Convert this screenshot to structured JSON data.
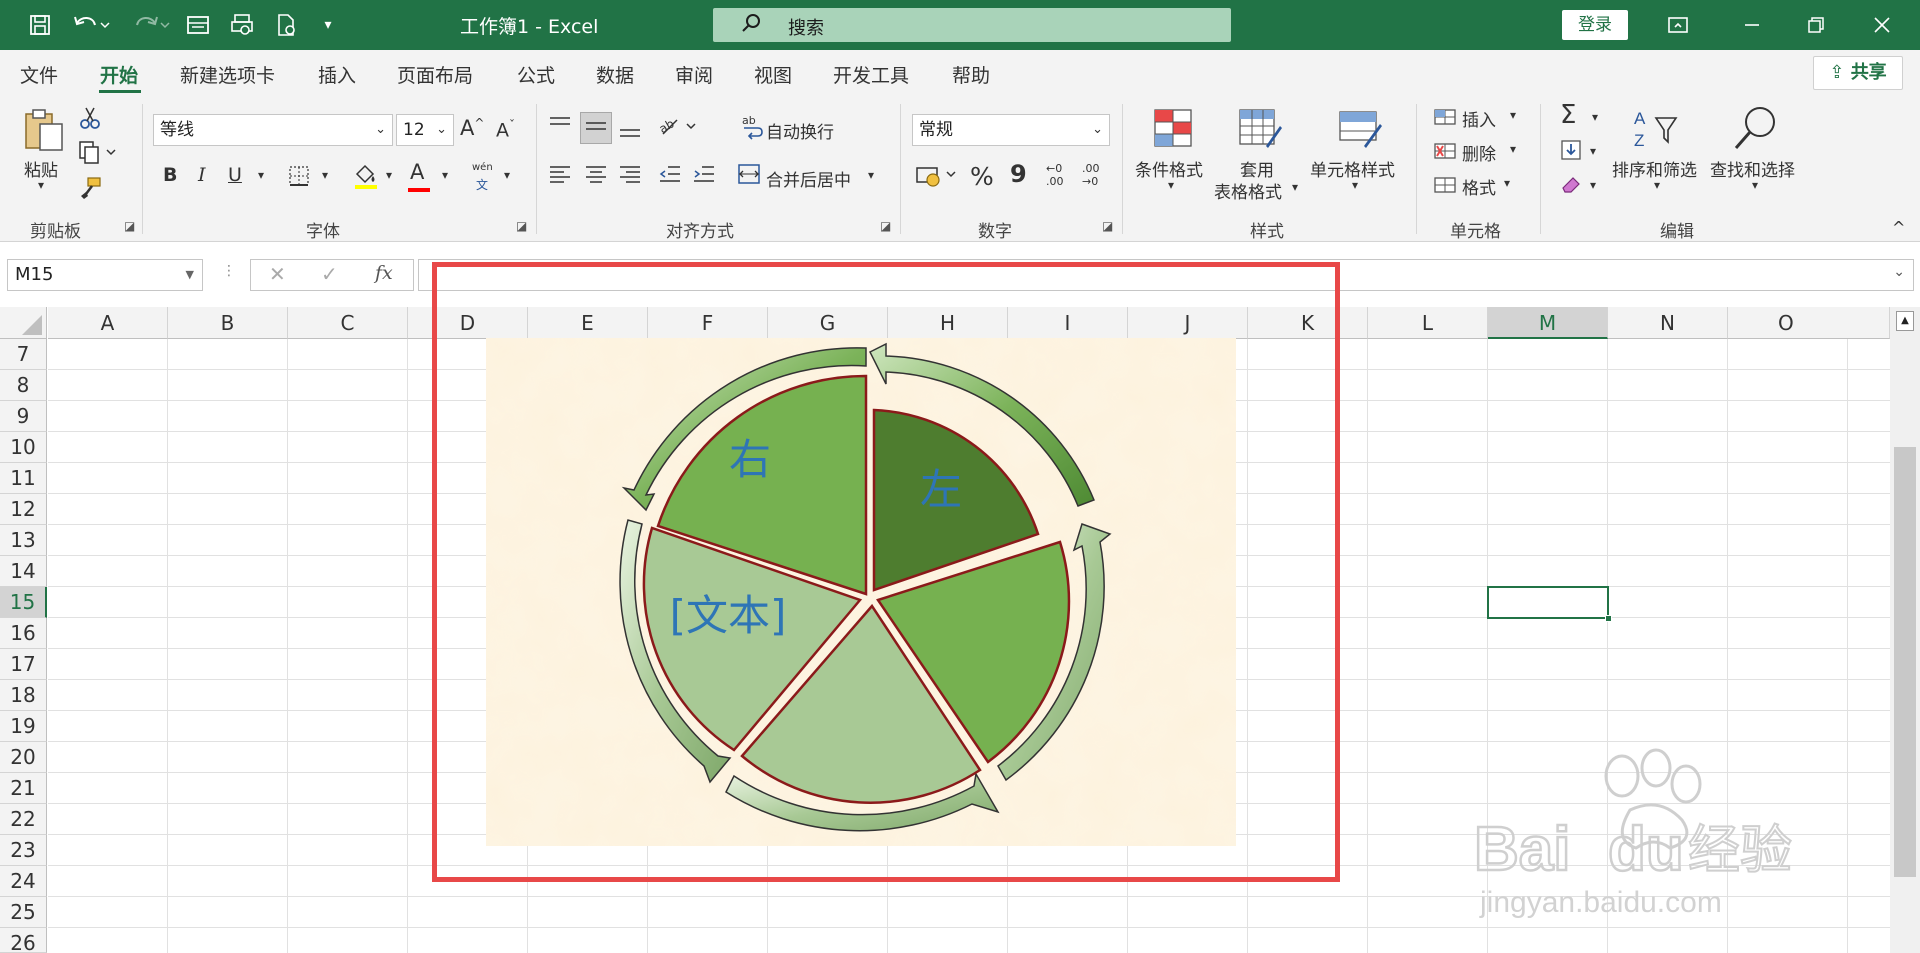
{
  "titlebar": {
    "title": "工作簿1  -  Excel",
    "search_placeholder": "搜索",
    "login_label": "登录",
    "icons": [
      "save-icon",
      "undo-icon",
      "redo-icon",
      "form-icon",
      "print-preview-icon",
      "document-icon",
      "customize-icon"
    ]
  },
  "menu": {
    "tabs": [
      "文件",
      "开始",
      "新建选项卡",
      "插入",
      "页面布局",
      "公式",
      "数据",
      "审阅",
      "视图",
      "开发工具",
      "帮助"
    ],
    "active_tab": "开始",
    "share_label": "共享"
  },
  "ribbon": {
    "clipboard": {
      "paste_label": "粘贴",
      "group_label": "剪贴板"
    },
    "font": {
      "font_name": "等线",
      "font_size": "12",
      "group_label": "字体",
      "bold": "B",
      "italic": "I",
      "underline": "U",
      "grow": "A",
      "shrink": "A",
      "phonetic_top": "wén",
      "phonetic_bottom": "文",
      "font_color": "A"
    },
    "alignment": {
      "wrap_label": "自动换行",
      "merge_label": "合并后居中",
      "group_label": "对齐方式"
    },
    "number": {
      "format": "常规",
      "group_label": "数字",
      "percent": "%",
      "comma": "9",
      "inc_decimal_top": "←0",
      "inc_decimal_bottom": ".00",
      "dec_decimal_top": ".00",
      "dec_decimal_bottom": "→0"
    },
    "styles": {
      "conditional_label": "条件格式",
      "table_label_1": "套用",
      "table_label_2": "表格格式",
      "cell_styles_label": "单元格样式",
      "group_label": "样式"
    },
    "cells": {
      "insert_label": "插入",
      "delete_label": "删除",
      "format_label": "格式",
      "group_label": "单元格"
    },
    "editing": {
      "sort_label": "排序和筛选",
      "find_label": "查找和选择",
      "group_label": "编辑",
      "sort_a": "A",
      "sort_z": "Z"
    }
  },
  "formula_bar": {
    "name_box": "M15",
    "cancel": "✕",
    "enter": "✓",
    "fx": "fx",
    "value": ""
  },
  "grid": {
    "columns": [
      "A",
      "B",
      "C",
      "D",
      "E",
      "F",
      "G",
      "H",
      "I",
      "J",
      "K",
      "L",
      "M",
      "N",
      "O"
    ],
    "selected_column": "M",
    "rows": [
      "7",
      "8",
      "9",
      "10",
      "11",
      "12",
      "13",
      "14",
      "15",
      "16",
      "17",
      "18",
      "19",
      "20",
      "21",
      "22",
      "23",
      "24",
      "25",
      "26"
    ],
    "selected_row": "15",
    "selected_cell": "M15"
  },
  "smartart": {
    "segment_labels": [
      "右",
      "左",
      "[文本]"
    ],
    "colors": {
      "dark_green": "#4e7d2f",
      "mid_green": "#76b150",
      "light_green": "#a8c995",
      "outline": "#8b1a1a",
      "background": "#fdf0d8",
      "arrow": "#7cb35a",
      "text": "#2e75b6"
    }
  },
  "watermark": {
    "brand": "Bai",
    "brand2": "du",
    "cn": "经验",
    "url": "jingyan.baidu.com"
  }
}
